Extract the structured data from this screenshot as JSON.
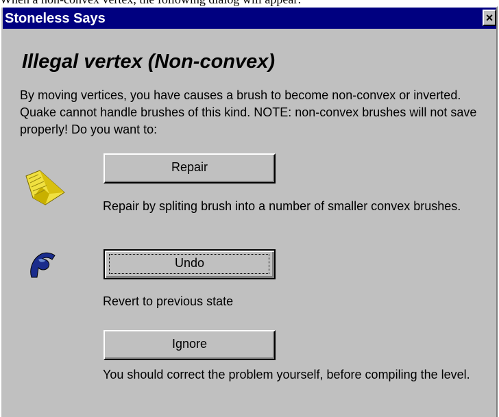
{
  "page_top_text": "When a non-convex vertex, the following dialog will appear:",
  "window": {
    "title": "Stoneless Says",
    "close_label": "×"
  },
  "dialog": {
    "heading": "Illegal vertex (Non-convex)",
    "message": "By moving vertices, you have causes a brush to become non-convex or inverted. Quake cannot handle brushes of this kind. NOTE: non-convex brushes will not save properly! Do you want to:"
  },
  "options": {
    "repair": {
      "icon": "repair-wedge-icon",
      "label": "Repair",
      "description": "Repair by spliting brush into a number of smaller convex brushes."
    },
    "undo": {
      "icon": "undo-icon",
      "label": "Undo",
      "description": "Revert to previous state"
    },
    "ignore": {
      "label": "Ignore",
      "description": "You should correct the problem yourself, before compiling the level."
    }
  },
  "colors": {
    "titlebar": "#000080",
    "dialog_face": "#c0c0c0",
    "repair_icon": "#e8d820",
    "undo_icon": "#1a2c8c"
  }
}
